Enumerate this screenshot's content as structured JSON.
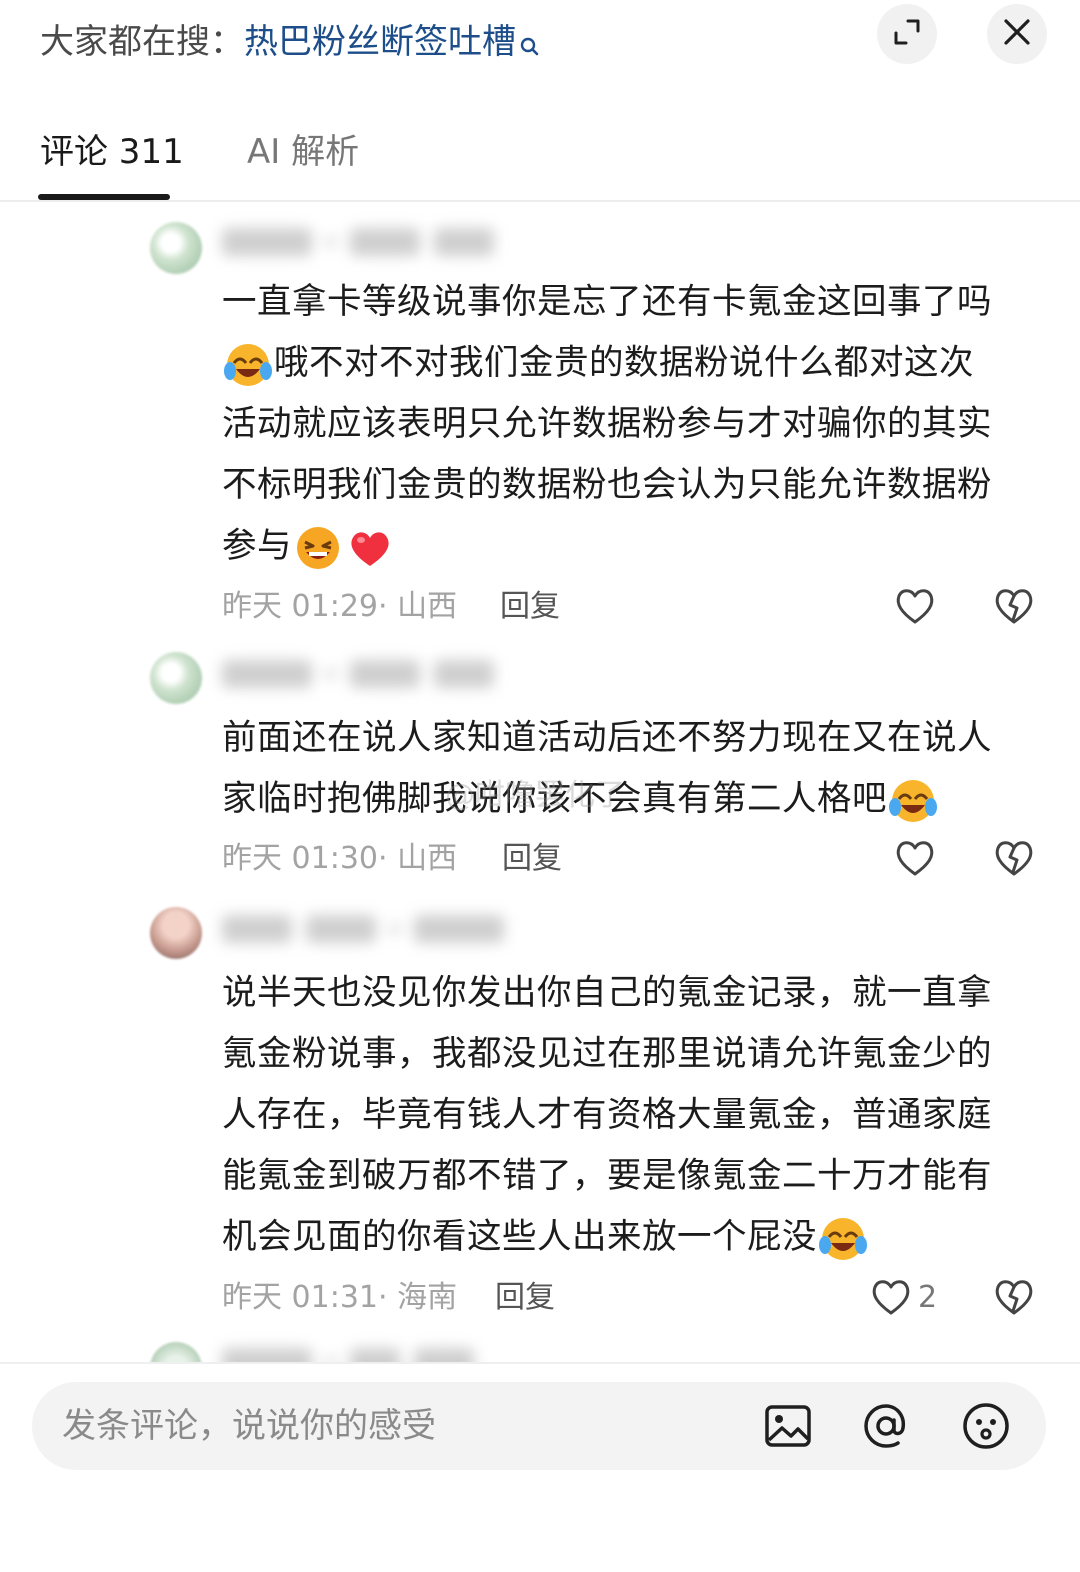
{
  "search": {
    "prefix": "大家都在搜：",
    "term": "热巴粉丝断签吐槽"
  },
  "tabs": {
    "comments": "评论 311",
    "ai": "AI 解析"
  },
  "comments": [
    {
      "lines": [
        "一直拿卡等级说事你是忘了还有卡氪金这回事了吗",
        "哦不对不对我们金贵的数据粉说什么都对这次",
        "活动就应该表明只允许数据粉参与才对骗你的其实",
        "不标明我们金贵的数据粉也会认为只能允许数据粉",
        "参与"
      ],
      "time": "昨天 01:29· 山西",
      "reply": "回复"
    },
    {
      "lines": [
        "前面还在说人家知道活动后还不努力现在又在说人",
        "家临时抱佛脚我说你该不会真有第二人格吧"
      ],
      "time": "昨天 01:30· 山西",
      "reply": "回复"
    },
    {
      "lines": [
        "说半天也没见你发出你自己的氪金记录，就一直拿",
        "氪金粉说事，我都没见过在那里说请允许氪金少的",
        "人存在，毕竟有钱人才有资格大量氪金，普通家庭",
        "能氪金到破万都不错了，要是像氪金二十万才能有",
        "机会见面的你看这些人出来放一个屁没"
      ],
      "time": "昨天 01:31· 海南",
      "reply": "回复",
      "likes": "2"
    }
  ],
  "watermark": "@咁噜罢化了",
  "input": {
    "placeholder": "发条评论，说说你的感受"
  },
  "colors": {
    "search_term": "#1d4e8a",
    "text": "#1c1c1c",
    "meta": "#a3a3a3"
  },
  "icons": [
    "search-icon",
    "expand-icon",
    "close-icon",
    "heart-icon",
    "broken-heart-icon",
    "image-icon",
    "at-icon",
    "emoji-icon"
  ]
}
